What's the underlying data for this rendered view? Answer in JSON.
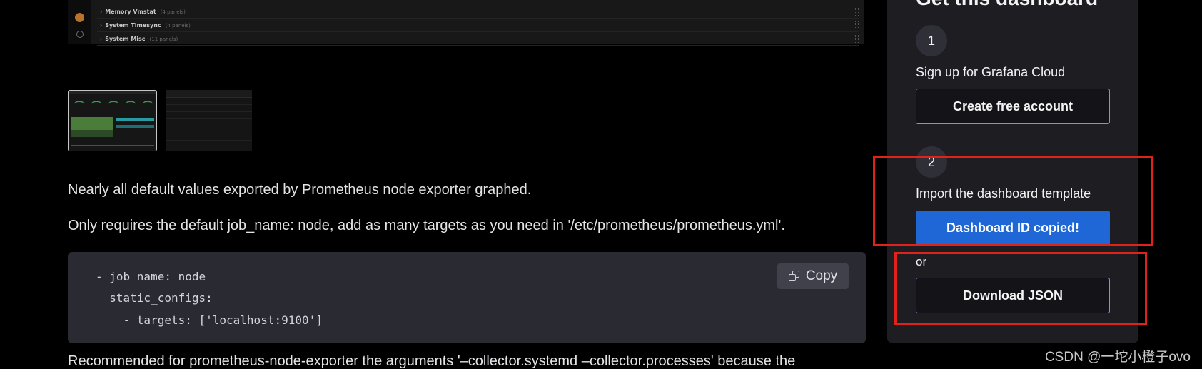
{
  "preview": {
    "rows": [
      {
        "label": "Memory Vmstat",
        "sub": "(4 panels)"
      },
      {
        "label": "System Timesync",
        "sub": "(4 panels)"
      },
      {
        "label": "System Misc",
        "sub": "(11 panels)"
      }
    ]
  },
  "thumbnails": [
    {
      "name": "thumbnail-1",
      "selected": true
    },
    {
      "name": "thumbnail-2",
      "selected": false
    }
  ],
  "body": {
    "para1": "Nearly all default values exported by Prometheus node exporter graphed.",
    "para2": "Only requires the default job_name: node, add as many targets as you need in '/etc/prometheus/prometheus.yml'.",
    "para3": "Recommended for prometheus-node-exporter the arguments '–collector.systemd –collector.processes' because the"
  },
  "code": {
    "line1": "- job_name: node",
    "line2": "  static_configs:",
    "line3": "    - targets: ['localhost:9100']",
    "copy_label": "Copy",
    "copy_icon": "copy-icon"
  },
  "sidebar": {
    "title": "Get this dashboard",
    "step1_number": "1",
    "step1_text": "Sign up for Grafana Cloud",
    "create_account_label": "Create free account",
    "step2_number": "2",
    "step2_text": "Import the dashboard template",
    "dashboard_id_label": "Dashboard ID copied!",
    "or_text": "or",
    "download_json_label": "Download JSON"
  },
  "colors": {
    "primary_button": "#1f67d6",
    "highlight_border": "#e0221a",
    "card_bg": "#1d1d22"
  },
  "watermark": "CSDN @一坨小橙子ovo"
}
